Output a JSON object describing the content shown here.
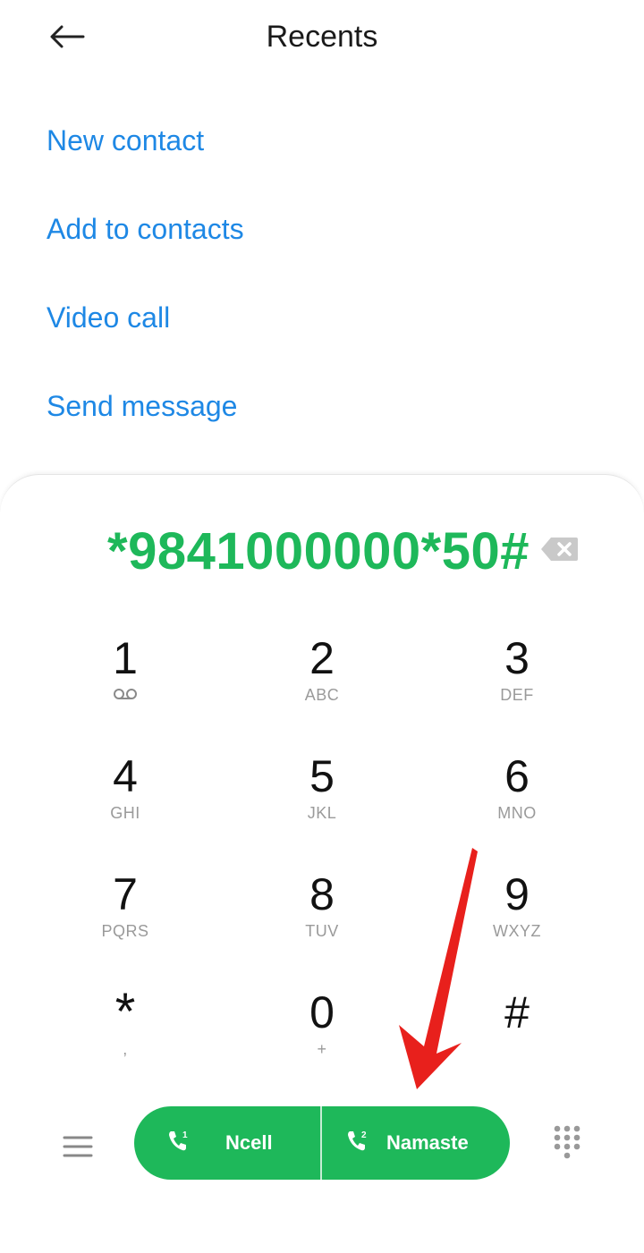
{
  "header": {
    "title": "Recents",
    "back_icon": "arrow-left-icon"
  },
  "menu": {
    "items": [
      "New contact",
      "Add to contacts",
      "Video call",
      "Send message"
    ]
  },
  "dialer": {
    "number": "*9841000000*50#",
    "backspace_icon": "backspace-icon",
    "keys": [
      {
        "digit": "1",
        "letters": ""
      },
      {
        "digit": "2",
        "letters": "ABC"
      },
      {
        "digit": "3",
        "letters": "DEF"
      },
      {
        "digit": "4",
        "letters": "GHI"
      },
      {
        "digit": "5",
        "letters": "JKL"
      },
      {
        "digit": "6",
        "letters": "MNO"
      },
      {
        "digit": "7",
        "letters": "PQRS"
      },
      {
        "digit": "8",
        "letters": "TUV"
      },
      {
        "digit": "9",
        "letters": "WXYZ"
      },
      {
        "digit": "*",
        "letters": ","
      },
      {
        "digit": "0",
        "letters": "+"
      },
      {
        "digit": "#",
        "letters": ""
      }
    ],
    "voicemail_icon": "voicemail-icon"
  },
  "bottom_bar": {
    "menu_icon": "hamburger-menu-icon",
    "sim1": {
      "label": "Ncell",
      "badge": "1"
    },
    "sim2": {
      "label": "Namaste",
      "badge": "2"
    },
    "keypad_icon": "dialpad-icon"
  },
  "colors": {
    "accent_blue": "#1e88e5",
    "call_green": "#1eb85a",
    "annotation_red": "#e8201c"
  }
}
